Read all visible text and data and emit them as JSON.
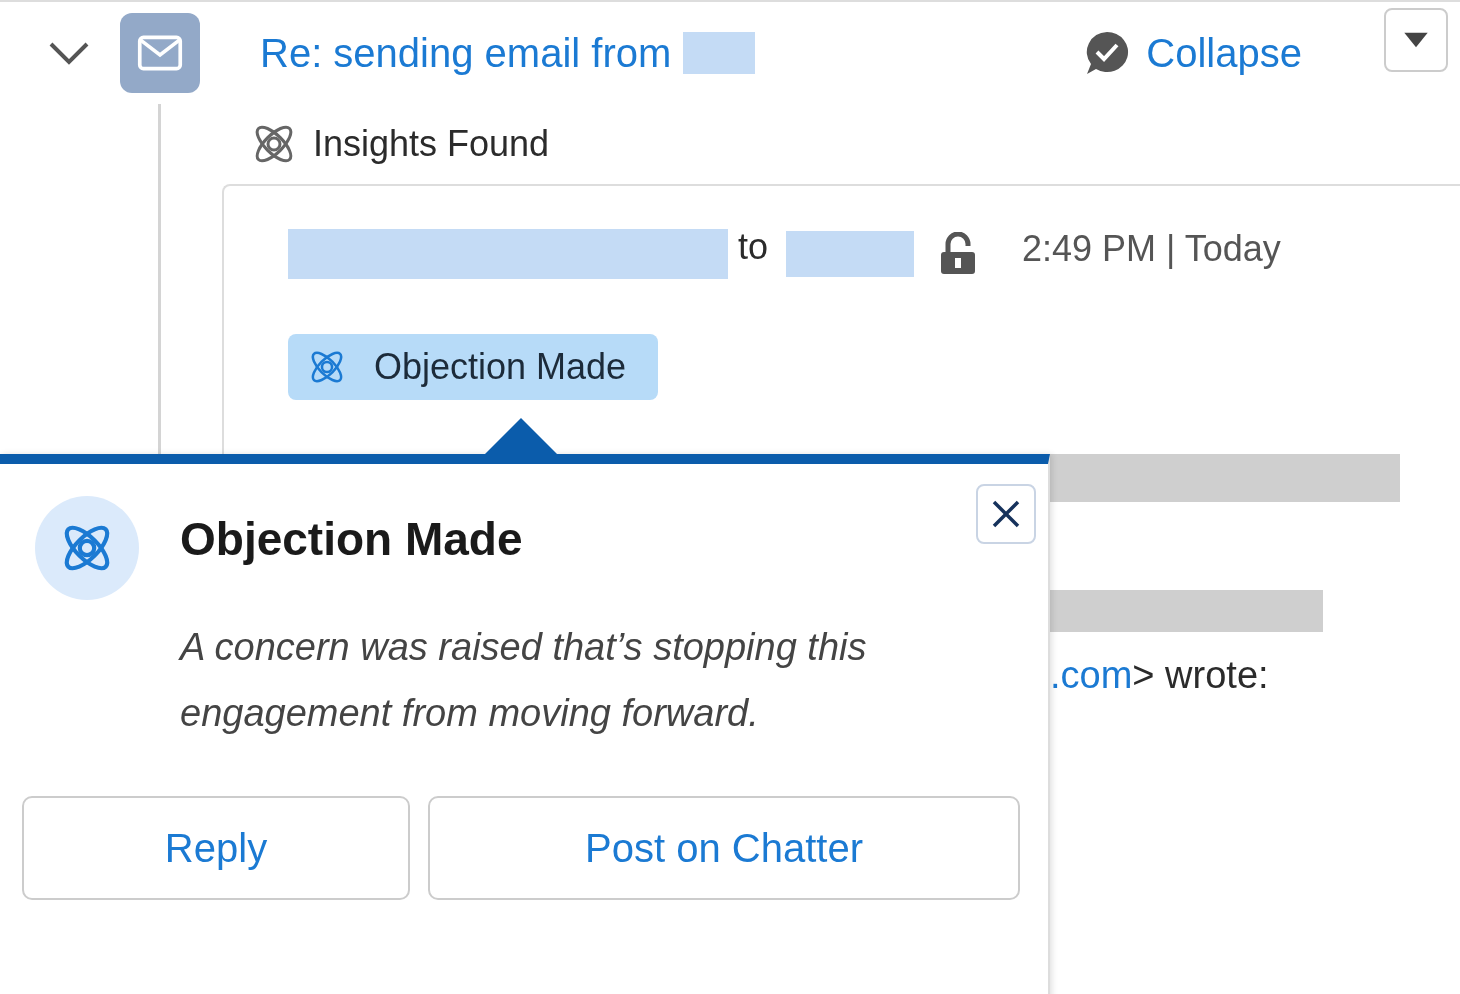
{
  "email": {
    "expanded": true,
    "subject": "Re: sending email from",
    "collapse_label": "Collapse",
    "insights_label": "Insights Found",
    "to_label": "to",
    "time": "2:49 PM | Today",
    "insight_badge": {
      "label": "Objection Made"
    }
  },
  "quoted_text": {
    "link": ".com",
    "rest": "> wrote:"
  },
  "popover": {
    "title": "Objection Made",
    "description": "A concern was raised that’s stopping this engagement from moving forward.",
    "buttons": [
      "Reply",
      "Post on Chatter"
    ]
  }
}
